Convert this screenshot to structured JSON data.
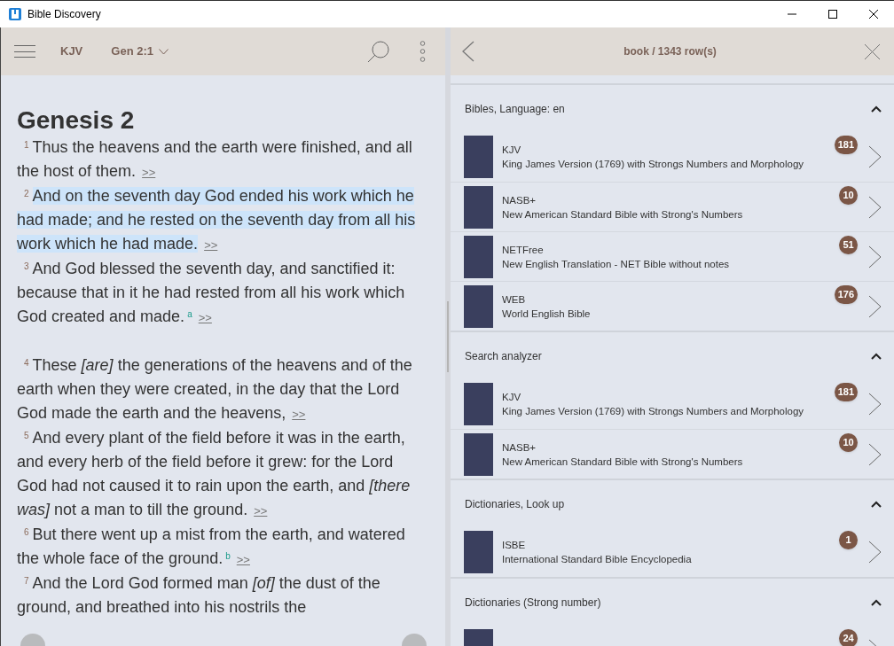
{
  "window": {
    "title": "Bible Discovery"
  },
  "reader": {
    "version": "KJV",
    "reference": "Gen 2:1",
    "chapter_title": "Genesis 2",
    "verses": [
      {
        "number": "1",
        "text": "Thus the heavens and the earth were finished, and all the host of them.",
        "link": ">>",
        "selected": false,
        "new_paragraph": false
      },
      {
        "number": "2",
        "text": "And on the seventh day God ended his work which he had made; and he rested on the seventh day from all his work which he had made.",
        "link": ">>",
        "selected": true,
        "new_paragraph": false
      },
      {
        "number": "3",
        "text": "And God blessed the seventh day, and sanctified it: because that in it he had rested from all his work which God created and made.",
        "footnote": "a",
        "link": ">>",
        "selected": false,
        "new_paragraph": false
      },
      {
        "number": "4",
        "text": "These *[are]* the generations of the heavens and of the earth when they were created, in the day that the Lord God made the earth and the heavens,",
        "link": ">>",
        "selected": false,
        "new_paragraph": true
      },
      {
        "number": "5",
        "text": "And every plant of the field before it was in the earth, and every herb of the field before it grew: for the Lord God had not caused it to rain upon the earth, and *[there was]* not a man to till the ground.",
        "link": ">>",
        "selected": false,
        "new_paragraph": false
      },
      {
        "number": "6",
        "text": "But there went up a mist from the earth, and watered the whole face of the ground.",
        "footnote": "b",
        "link": ">>",
        "selected": false,
        "new_paragraph": false
      },
      {
        "number": "7",
        "text": "And the Lord God formed man *[of]* the dust of the ground, and breathed into his nostrils the",
        "selected": false,
        "new_paragraph": false
      }
    ]
  },
  "results": {
    "title": "book / 1343 row(s)",
    "sections": [
      {
        "title": "Bibles, Language: en",
        "expanded": true,
        "items": [
          {
            "name": "KJV",
            "description": "King James Version (1769) with Strongs Numbers and Morphology",
            "count": "181"
          },
          {
            "name": "NASB+",
            "description": "New American Standard Bible with Strong's Numbers",
            "count": "10"
          },
          {
            "name": "NETFree",
            "description": "New English Translation - NET Bible without notes",
            "count": "51"
          },
          {
            "name": "WEB",
            "description": "World English Bible",
            "count": "176"
          }
        ]
      },
      {
        "title": "Search analyzer",
        "expanded": true,
        "items": [
          {
            "name": "KJV",
            "description": "King James Version (1769) with Strongs Numbers and Morphology",
            "count": "181"
          },
          {
            "name": "NASB+",
            "description": "New American Standard Bible with Strong's Numbers",
            "count": "10"
          }
        ]
      },
      {
        "title": "Dictionaries, Look up",
        "expanded": true,
        "items": [
          {
            "name": "ISBE",
            "description": "International Standard Bible Encyclopedia",
            "count": "1"
          }
        ]
      },
      {
        "title": "Dictionaries (Strong number)",
        "expanded": true,
        "items": [
          {
            "count": "24"
          }
        ]
      }
    ]
  }
}
